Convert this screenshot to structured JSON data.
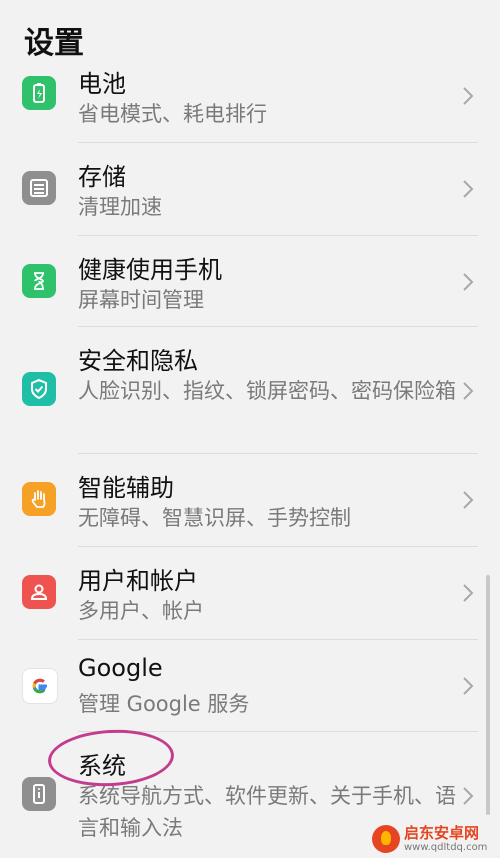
{
  "header": {
    "title": "设置"
  },
  "items": [
    {
      "title": "电池",
      "subtitle": "省电模式、耗电排行",
      "icon": "battery-icon",
      "color": "#2fc26b"
    },
    {
      "title": "存储",
      "subtitle": "清理加速",
      "icon": "storage-icon",
      "color": "#8f8f8f"
    },
    {
      "title": "健康使用手机",
      "subtitle": "屏幕时间管理",
      "icon": "hourglass-icon",
      "color": "#2fc26b"
    },
    {
      "title": "安全和隐私",
      "subtitle": "人脸识别、指纹、锁屏密码、密码保险箱",
      "icon": "shield-icon",
      "color": "#1fbfa7"
    },
    {
      "title": "智能辅助",
      "subtitle": "无障碍、智慧识屏、手势控制",
      "icon": "hand-icon",
      "color": "#f5a125"
    },
    {
      "title": "用户和帐户",
      "subtitle": "多用户、帐户",
      "icon": "user-icon",
      "color": "#ef5350"
    },
    {
      "title": "Google",
      "subtitle": "管理 Google 服务",
      "icon": "google-icon",
      "color": "#ffffff"
    },
    {
      "title": "系统",
      "subtitle": "系统导航方式、软件更新、关于手机、语言和输入法",
      "icon": "phone-info-icon",
      "color": "#8f8f8f"
    }
  ],
  "watermark": {
    "title": "启东安卓网",
    "url": "www.qdltdq.com"
  }
}
